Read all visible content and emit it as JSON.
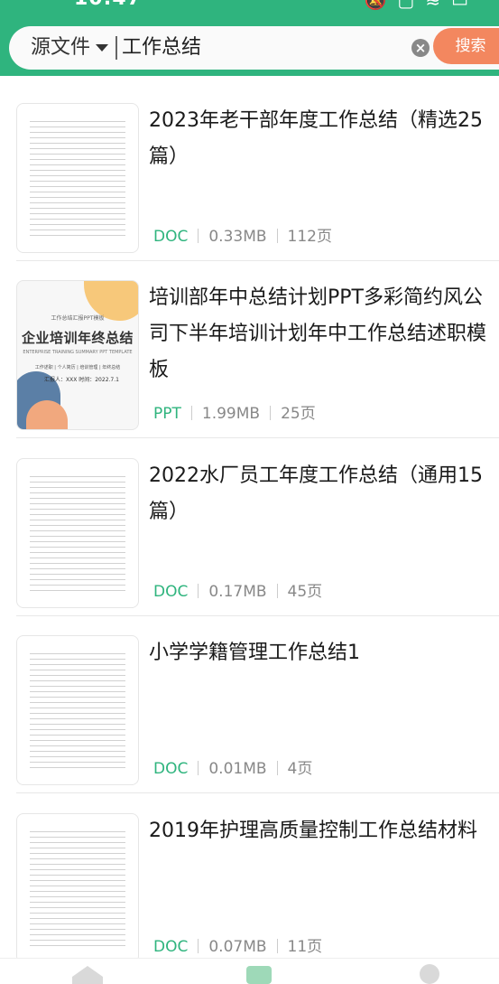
{
  "status_bar": {
    "time": "10:47",
    "icons": [
      "bell-off-icon",
      "square-icon",
      "wifi-icon",
      "battery-icon"
    ]
  },
  "search": {
    "scope_label": "源文件",
    "query": "工作总结",
    "button_label": "搜索"
  },
  "colors": {
    "accent": "#2fb47e",
    "search_button": "#f3875f"
  },
  "results": [
    {
      "title": "2023年老干部年度工作总结（精选25篇）",
      "type": "DOC",
      "size": "0.33MB",
      "pages": "112页"
    },
    {
      "title": "培训部年中总结计划PPT多彩简约风公司下半年培训计划年中工作总结述职模板",
      "type": "PPT",
      "size": "1.99MB",
      "pages": "25页",
      "thumb": {
        "top_text": "工作总结汇报PPT模板",
        "title": "企业培训年终总结",
        "sub": "ENTERPRISE TRAINING SUMMARY PPT TEMPLATE",
        "info": "工作述职 | 个人简历 | 培训管理 | 年终总结",
        "date": "汇报人：XXX 时间：2022.7.1"
      }
    },
    {
      "title": "2022水厂员工年度工作总结（通用15篇）",
      "type": "DOC",
      "size": "0.17MB",
      "pages": "45页"
    },
    {
      "title": "小学学籍管理工作总结1",
      "type": "DOC",
      "size": "0.01MB",
      "pages": "4页"
    },
    {
      "title": "2019年护理高质量控制工作总结材料",
      "type": "DOC",
      "size": "0.07MB",
      "pages": "11页"
    }
  ],
  "bottom_nav": [
    "home-icon",
    "apps-icon",
    "profile-icon"
  ]
}
